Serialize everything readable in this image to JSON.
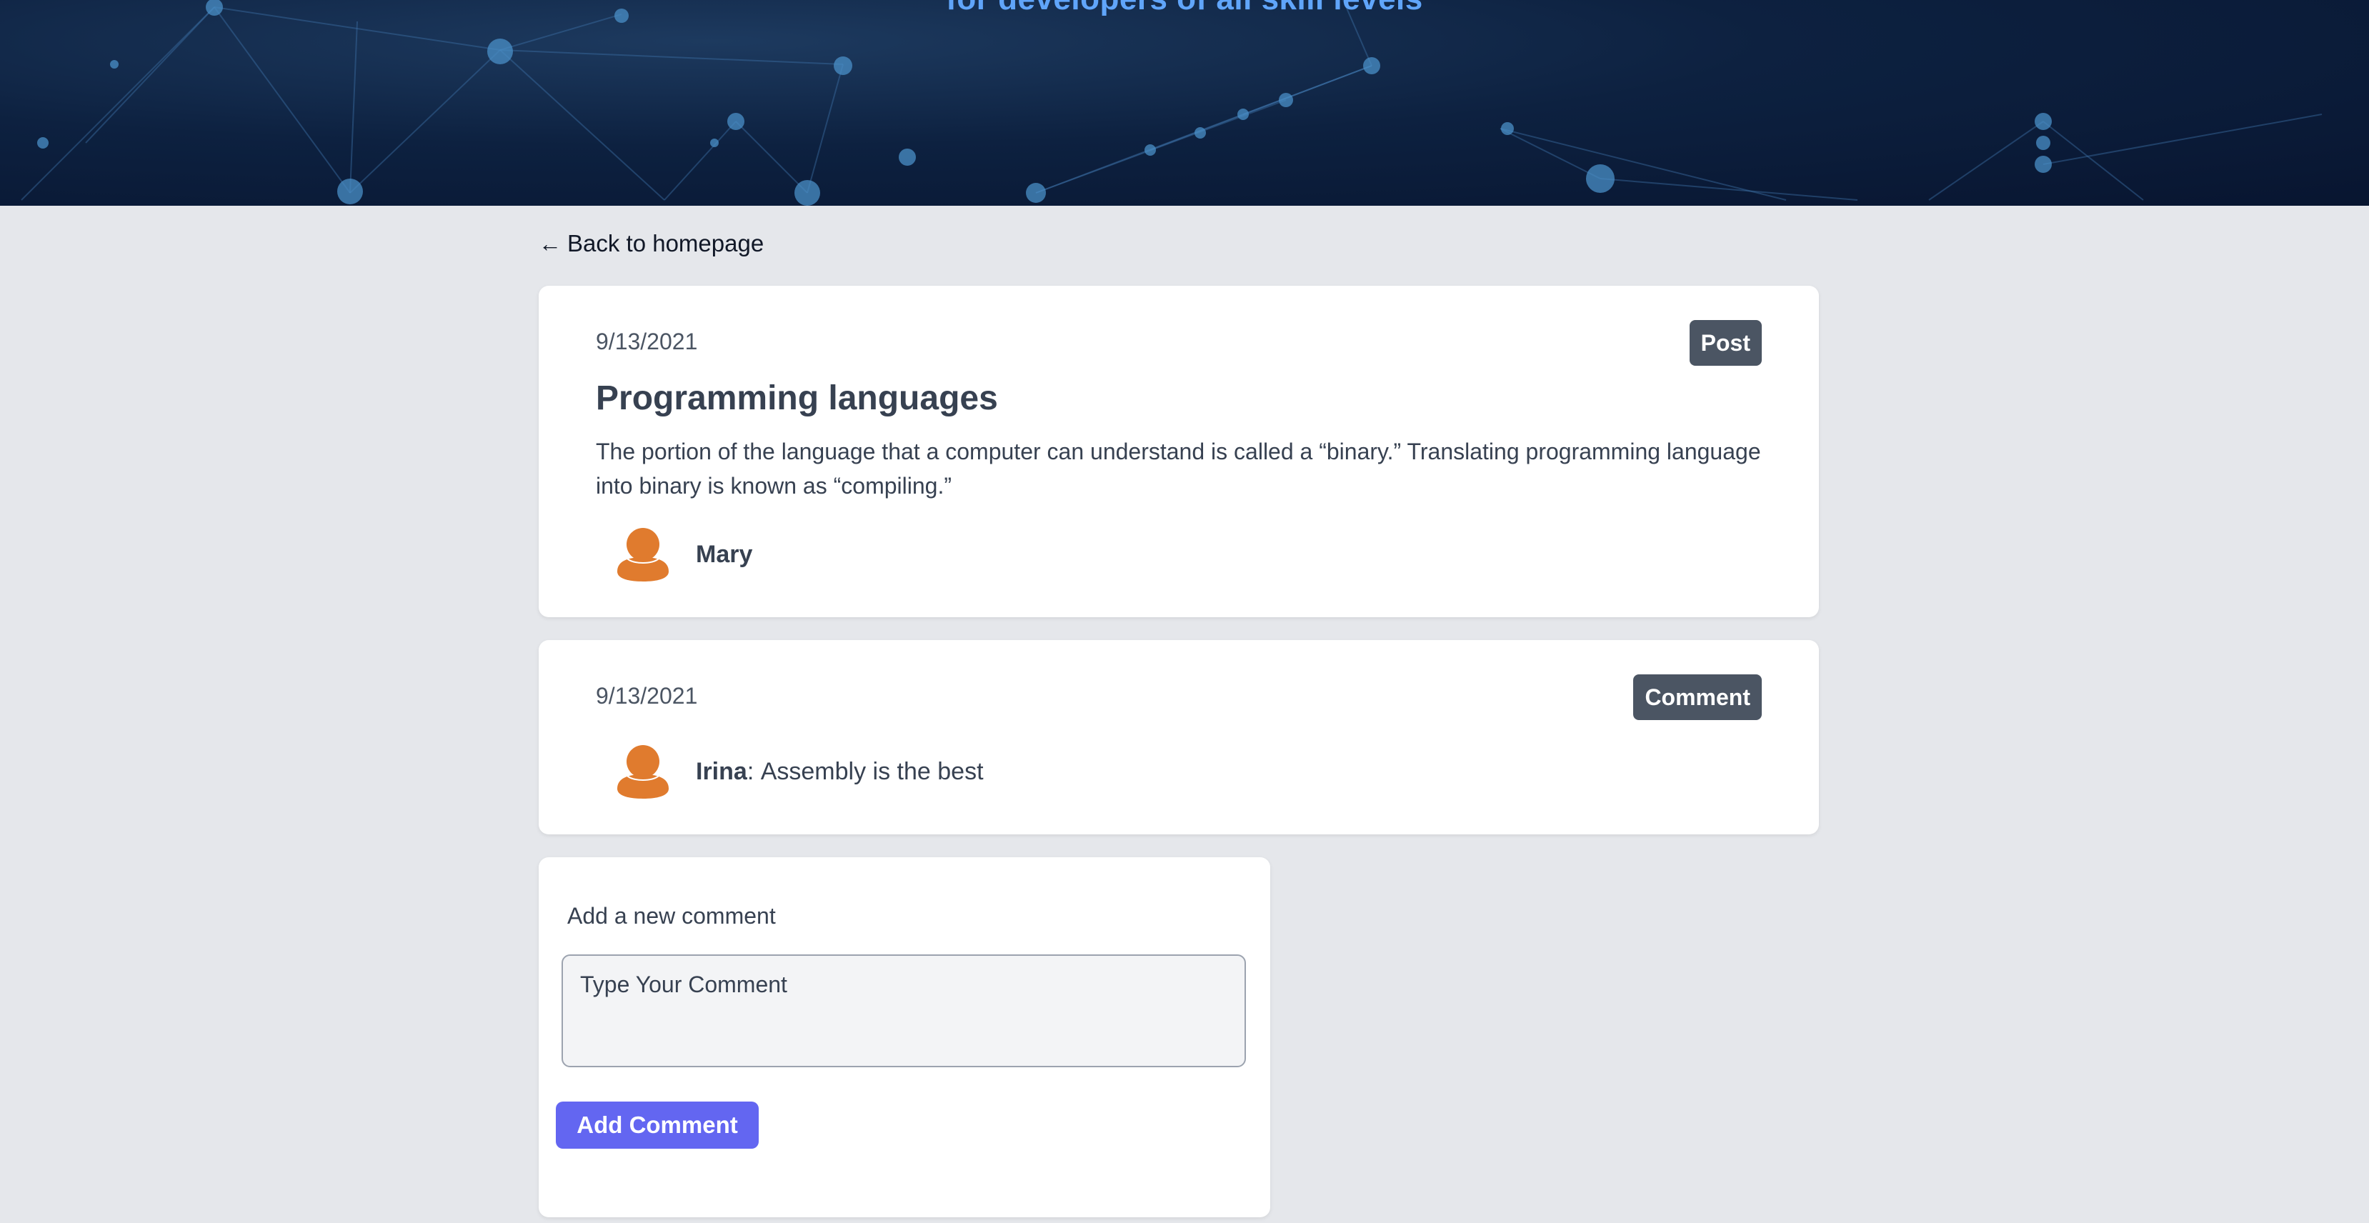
{
  "hero": {
    "tagline": "for developers of all skill levels"
  },
  "nav": {
    "back_label": "Back to homepage",
    "back_icon": "arrow-left-icon"
  },
  "post": {
    "date": "9/13/2021",
    "badge": "Post",
    "title": "Programming languages",
    "body": "The portion of the language that a computer can understand is called a “binary.” Translating programming language into binary is known as “compiling.”",
    "author": "Mary",
    "avatar_icon": "user-avatar-icon"
  },
  "comments": [
    {
      "date": "9/13/2021",
      "badge": "Comment",
      "author": "Irina",
      "separator": ": ",
      "text": "Assembly is the best",
      "avatar_icon": "user-avatar-icon"
    }
  ],
  "new_comment": {
    "title": "Add a new comment",
    "placeholder": "Type Your Comment",
    "value": "",
    "button_label": "Add Comment"
  },
  "colors": {
    "page_background": "#e5e7eb",
    "hero_background": "#0d2140",
    "tagline": "#60a5fa",
    "badge_background": "#4b5563",
    "avatar": "#e07b2e",
    "button": "#6366f1"
  }
}
